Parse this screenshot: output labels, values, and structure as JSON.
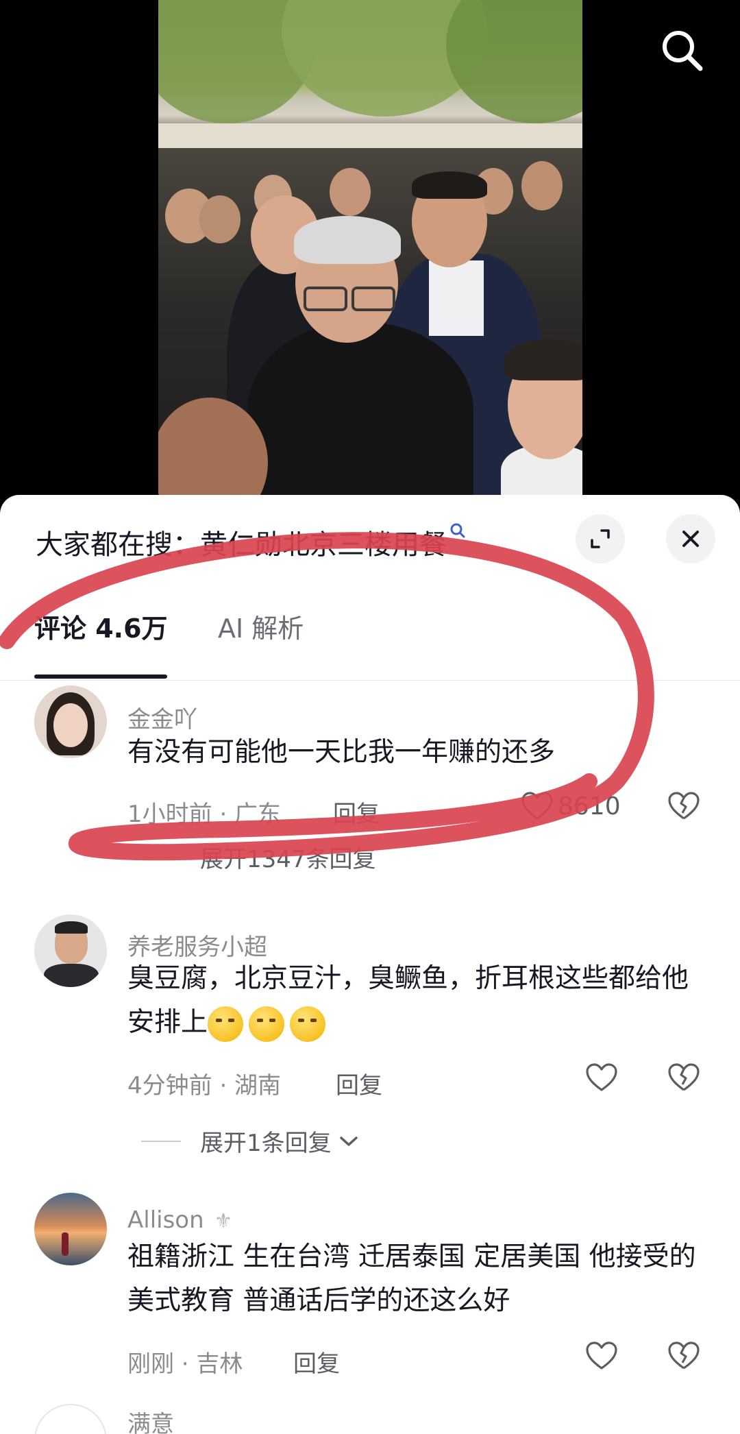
{
  "top": {
    "search_icon": "search-icon"
  },
  "sheet": {
    "topic_title": "大家都在搜：黄仁勋北京三楼用餐",
    "topic_icon": "search-small-icon",
    "expand_icon": "expand-icon",
    "close_icon": "close-icon"
  },
  "tabs": [
    {
      "label": "评论 4.6万"
    },
    {
      "label": "AI 解析"
    }
  ],
  "comments": [
    {
      "username": "金金吖",
      "text": "有没有可能他一天比我一年赚的还多",
      "time_location": "1小时前 · 广东",
      "reply_label": "回复",
      "likes": "8610",
      "expand_label": "展开1347条回复"
    },
    {
      "username": "养老服务小超",
      "text": "臭豆腐，北京豆汁，臭鳜鱼，折耳根这些都给他安排上",
      "time_location": "4分钟前 · 湖南",
      "reply_label": "回复",
      "likes": "",
      "expand_label": "展开1条回复"
    },
    {
      "username": "Allison",
      "badge": "⚜",
      "text": "祖籍浙江 生在台湾 迁居泰国 定居美国 他接受的美式教育 普通话后学的还这么好",
      "time_location": "刚刚 · 吉林",
      "reply_label": "回复",
      "likes": ""
    },
    {
      "username": "满意"
    }
  ],
  "annotation_color": "#d9434f"
}
